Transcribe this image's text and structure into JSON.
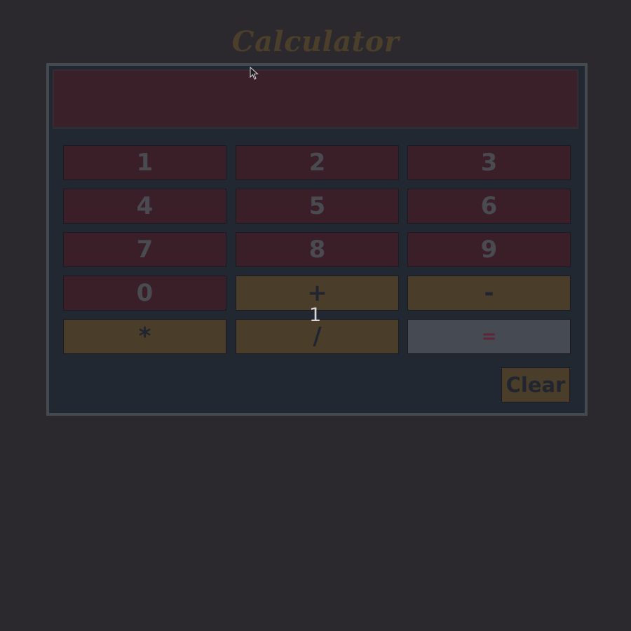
{
  "title": "Calculator",
  "display": {
    "value": ""
  },
  "keys": [
    {
      "label": "1",
      "kind": "num"
    },
    {
      "label": "2",
      "kind": "num"
    },
    {
      "label": "3",
      "kind": "num"
    },
    {
      "label": "4",
      "kind": "num"
    },
    {
      "label": "5",
      "kind": "num"
    },
    {
      "label": "6",
      "kind": "num"
    },
    {
      "label": "7",
      "kind": "num"
    },
    {
      "label": "8",
      "kind": "num"
    },
    {
      "label": "9",
      "kind": "num"
    },
    {
      "label": "0",
      "kind": "num"
    },
    {
      "label": "+",
      "kind": "op"
    },
    {
      "label": "-",
      "kind": "op"
    },
    {
      "label": "*",
      "kind": "op"
    },
    {
      "label": "/",
      "kind": "op"
    },
    {
      "label": "=",
      "kind": "eq"
    }
  ],
  "clear_label": "Clear",
  "floating_text": "1",
  "colors": {
    "background": "#2b292e",
    "calculator_body": "#212832",
    "number_key": "#3a1f28",
    "operator_key": "#4a3e2a",
    "equals_key": "#464a52",
    "title": "#4b3f2b"
  },
  "icons": {
    "cursor": "mouse-pointer-icon"
  }
}
